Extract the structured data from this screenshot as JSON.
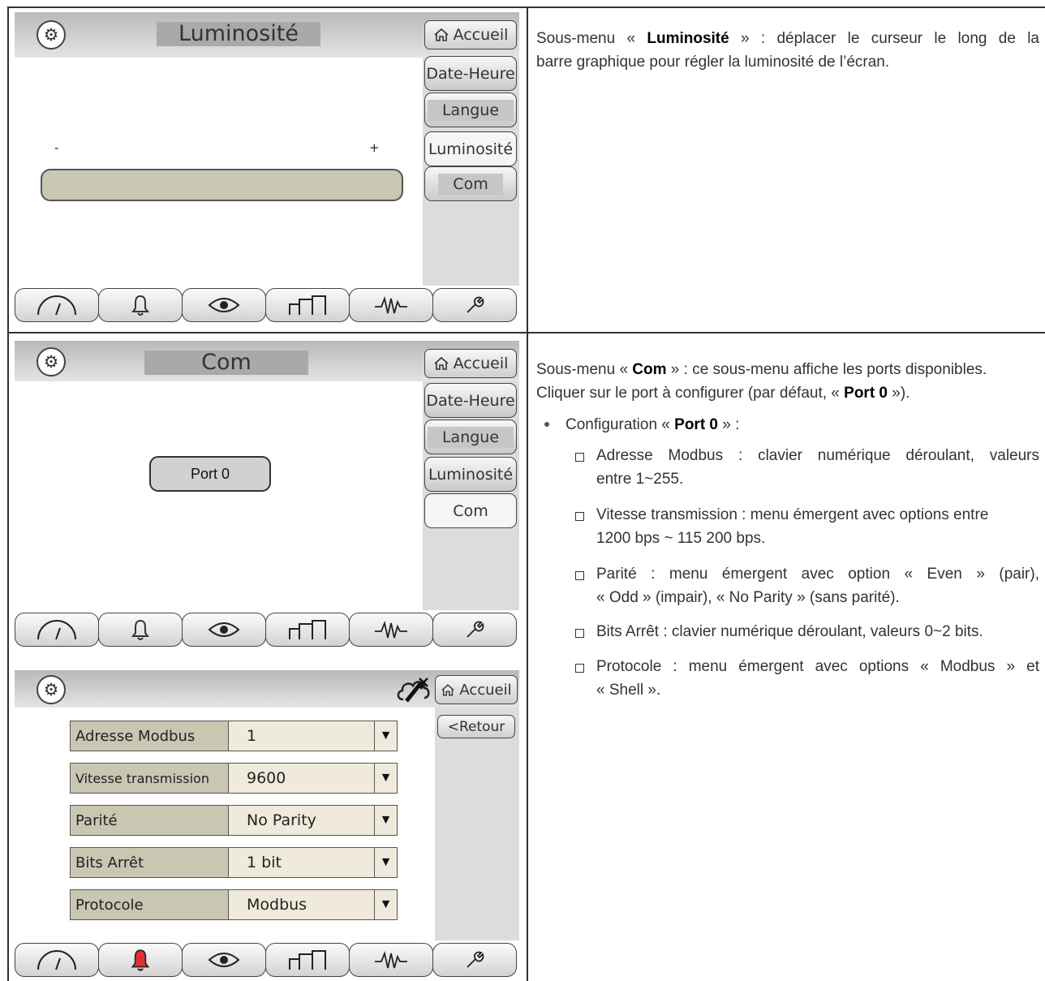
{
  "s1": {
    "title": "Luminosité",
    "home": "Accueil",
    "menu": [
      "Date-Heure",
      "Langue",
      "Luminosité",
      "Com"
    ],
    "minus": "-",
    "plus": "+"
  },
  "s2": {
    "title": "Com",
    "home": "Accueil",
    "menu": [
      "Date-Heure",
      "Langue",
      "Luminosité",
      "Com"
    ],
    "port": "Port 0"
  },
  "s3": {
    "home": "Accueil",
    "back": "<Retour",
    "rows": [
      {
        "label": "Adresse Modbus",
        "value": "1"
      },
      {
        "label": "Vitesse transmission",
        "value": "9600"
      },
      {
        "label": "Parité",
        "value": "No Parity"
      },
      {
        "label": "Bits Arrêt",
        "value": "1 bit"
      },
      {
        "label": "Protocole",
        "value": "Modbus"
      }
    ]
  },
  "icons": [
    "gauge-icon",
    "bell-icon",
    "eye-icon",
    "bars-icon",
    "wave-icon",
    "wrench-icon"
  ],
  "colors": {
    "alarm_red": "#e03030",
    "slider": "#c9c6b2",
    "field_bg": "#efeadb"
  },
  "text1": {
    "pre": "Sous-menu « ",
    "bold": "Luminosité",
    "post1": " » : déplacer le curseur le long de la",
    "line2": "barre graphique pour régler la luminosité de l’écran."
  },
  "text2": {
    "p1a": "Sous-menu « ",
    "p1b": "Com",
    "p1c": " » : ce sous-menu affiche les ports disponibles.",
    "p2a": "Cliquer sur le port à configurer (par défaut, « ",
    "p2b": "Port 0",
    "p2c": " »).",
    "b1a": "Configuration « ",
    "b1b": "Port 0",
    "b1c": " » :",
    "items": [
      [
        "Adresse Modbus : clavier numérique déroulant, valeurs",
        "entre 1~255."
      ],
      [
        "Vitesse transmission : menu émergent avec options entre",
        "1200 bps ~ 115 200 bps."
      ],
      [
        "Parité : menu émergent avec option « Even » (pair),",
        "« Odd » (impair), « No Parity » (sans parité)."
      ],
      [
        "Bits Arrêt : clavier numérique déroulant, valeurs 0~2 bits."
      ],
      [
        "Protocole : menu émergent avec options « Modbus » et",
        "« Shell »."
      ]
    ]
  }
}
